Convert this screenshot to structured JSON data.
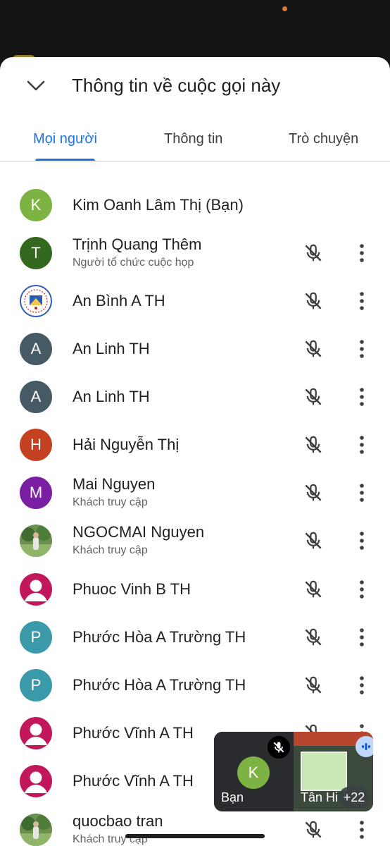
{
  "header": {
    "title": "Thông tin về cuộc gọi này",
    "back_icon": "chevron-down-icon"
  },
  "tabs": [
    {
      "label": "Mọi người",
      "active": true
    },
    {
      "label": "Thông tin",
      "active": false
    },
    {
      "label": "Trò chuyện",
      "active": false
    }
  ],
  "participants": [
    {
      "name": "Kim Oanh Lâm Thị (Bạn)",
      "subtitle": "",
      "avatar": {
        "type": "letter",
        "letter": "K",
        "color": "#7cb342"
      },
      "muted": false,
      "show_controls": false
    },
    {
      "name": "Trịnh Quang Thêm",
      "subtitle": "Người tổ chức cuộc họp",
      "avatar": {
        "type": "letter",
        "letter": "T",
        "color": "#33691e"
      },
      "muted": true,
      "show_controls": true
    },
    {
      "name": "An Bình A TH",
      "subtitle": "",
      "avatar": {
        "type": "school-logo"
      },
      "muted": true,
      "show_controls": true
    },
    {
      "name": "An Linh TH",
      "subtitle": "",
      "avatar": {
        "type": "letter",
        "letter": "A",
        "color": "#455a64"
      },
      "muted": true,
      "show_controls": true
    },
    {
      "name": "An Linh TH",
      "subtitle": "",
      "avatar": {
        "type": "letter",
        "letter": "A",
        "color": "#455a64"
      },
      "muted": true,
      "show_controls": true
    },
    {
      "name": "Hải Nguyễn Thị",
      "subtitle": "",
      "avatar": {
        "type": "letter",
        "letter": "H",
        "color": "#c44122"
      },
      "muted": true,
      "show_controls": true
    },
    {
      "name": "Mai Nguyen",
      "subtitle": "Khách truy cập",
      "avatar": {
        "type": "letter",
        "letter": "M",
        "color": "#7b1fa2"
      },
      "muted": true,
      "show_controls": true
    },
    {
      "name": "NGOCMAI Nguyen",
      "subtitle": "Khách truy cập",
      "avatar": {
        "type": "photo-outdoor"
      },
      "muted": true,
      "show_controls": true
    },
    {
      "name": "Phuoc Vinh B TH",
      "subtitle": "",
      "avatar": {
        "type": "person-silhouette",
        "color": "#c2185b"
      },
      "muted": true,
      "show_controls": true
    },
    {
      "name": "Phước Hòa A Trường TH",
      "subtitle": "",
      "avatar": {
        "type": "letter",
        "letter": "P",
        "color": "#3b9aa9"
      },
      "muted": true,
      "show_controls": true
    },
    {
      "name": "Phước Hòa A Trường TH",
      "subtitle": "",
      "avatar": {
        "type": "letter",
        "letter": "P",
        "color": "#3b9aa9"
      },
      "muted": true,
      "show_controls": true
    },
    {
      "name": "Phước Vĩnh A TH",
      "subtitle": "",
      "avatar": {
        "type": "person-silhouette",
        "color": "#c2185b"
      },
      "muted": true,
      "show_controls": true
    },
    {
      "name": "Phước Vĩnh A TH",
      "subtitle": "",
      "avatar": {
        "type": "person-silhouette",
        "color": "#c2185b"
      },
      "muted": true,
      "show_controls": true
    },
    {
      "name": "quocbao tran",
      "subtitle": "Khách truy cập",
      "avatar": {
        "type": "photo-outdoor"
      },
      "muted": true,
      "show_controls": true
    }
  ],
  "pip": {
    "self_label": "Bạn",
    "self_letter": "K",
    "self_color": "#7cb342",
    "self_muted_icon": "mic-off-icon",
    "other_label": "Tân Hi",
    "other_count": "+22",
    "speaking_icon": "speaking-indicator-icon"
  },
  "colors": {
    "accent": "#1a73e8",
    "text": "#202124",
    "secondary": "#5f6368"
  }
}
